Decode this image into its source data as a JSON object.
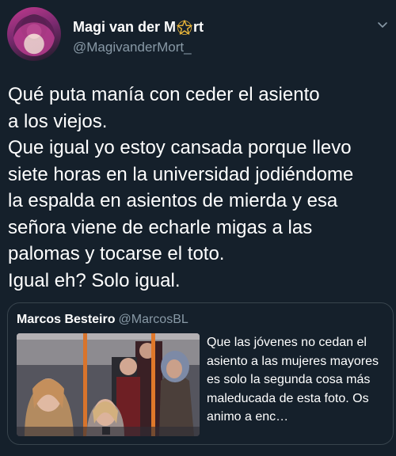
{
  "tweet": {
    "author": {
      "name_part1": "Magi van der M",
      "name_symbol": "pentagram-icon",
      "name_part2": "rt",
      "handle": "@MagivanderMort_"
    },
    "menu_icon": "chevron-down-icon",
    "text": "Qué puta manía con ceder el asiento\na los viejos.\nQue igual yo estoy cansada porque llevo\nsiete horas en la universidad jodiéndome\nla espalda en asientos de mierda y esa\nseñora viene de echarle migas a las\npalomas y tocarse el toto.\nIgual eh? Solo igual."
  },
  "quoted_tweet": {
    "author_name": "Marcos Besteiro",
    "handle": "@MarcosBL",
    "text": "Que las jóvenes no cedan el asiento a las mujeres mayores es solo la segunda cosa más maleducada de esta foto. Os animo a enc…"
  },
  "colors": {
    "background": "#15202b",
    "secondary_text": "#8899a6",
    "border": "#38444d",
    "pentagram": "#e8b53a"
  }
}
